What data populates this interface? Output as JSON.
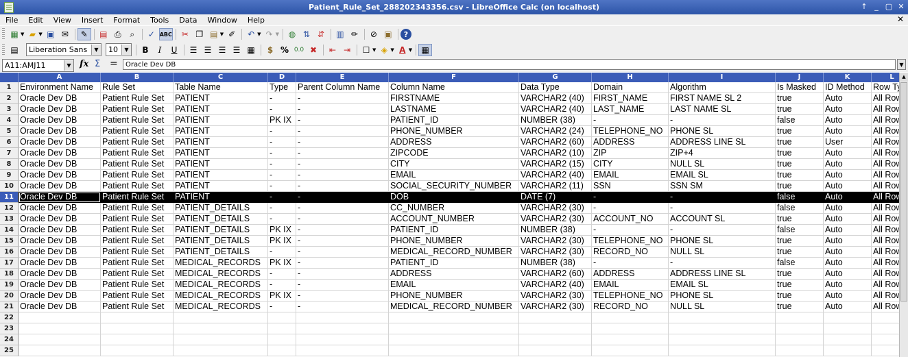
{
  "window": {
    "title": "Patient_Rule_Set_288202343356.csv - LibreOffice Calc (on localhost)",
    "buttons": [
      "↑",
      "_",
      "▢",
      "✕"
    ]
  },
  "menu": {
    "items": [
      "File",
      "Edit",
      "View",
      "Insert",
      "Format",
      "Tools",
      "Data",
      "Window",
      "Help"
    ],
    "close_doc": "✕"
  },
  "toolbar": {
    "font_name": "Liberation Sans",
    "font_size": "10",
    "bold": "B",
    "italic": "I",
    "underline": "U",
    "currency": "$",
    "percent": "%",
    "font_color": "A"
  },
  "formula_bar": {
    "name_box": "A11:AMJ11",
    "fx": "fx",
    "sigma": "Σ",
    "equals": "=",
    "content": "Oracle Dev DB"
  },
  "sheet": {
    "columns": [
      "A",
      "B",
      "C",
      "D",
      "E",
      "F",
      "G",
      "H",
      "I",
      "J",
      "K",
      "L"
    ],
    "row_numbers": [
      "1",
      "2",
      "3",
      "4",
      "5",
      "6",
      "7",
      "8",
      "9",
      "10",
      "11",
      "12",
      "13",
      "14",
      "15",
      "16",
      "17",
      "18",
      "19",
      "20",
      "21",
      "22",
      "23",
      "24",
      "25"
    ],
    "selected_row": 11,
    "rows": [
      [
        "Environment Name",
        "Rule Set",
        "Table Name",
        "Type",
        "Parent Column Name",
        "Column Name",
        "Data Type",
        "Domain",
        "Algorithm",
        "Is Masked",
        "ID Method",
        "Row Ty"
      ],
      [
        "Oracle Dev DB",
        "Patient Rule Set",
        "PATIENT",
        "-",
        "-",
        "FIRSTNAME",
        "VARCHAR2 (40)",
        "FIRST_NAME",
        "FIRST NAME SL 2",
        "true",
        "Auto",
        "All Row"
      ],
      [
        "Oracle Dev DB",
        "Patient Rule Set",
        "PATIENT",
        "-",
        "-",
        "LASTNAME",
        "VARCHAR2 (40)",
        "LAST_NAME",
        "LAST NAME SL",
        "true",
        "Auto",
        "All Row"
      ],
      [
        "Oracle Dev DB",
        "Patient Rule Set",
        "PATIENT",
        "PK IX",
        "-",
        "PATIENT_ID",
        "NUMBER (38)",
        "-",
        "-",
        "false",
        "Auto",
        "All Row"
      ],
      [
        "Oracle Dev DB",
        "Patient Rule Set",
        "PATIENT",
        "-",
        "-",
        "PHONE_NUMBER",
        "VARCHAR2 (24)",
        "TELEPHONE_NO",
        "PHONE SL",
        "true",
        "Auto",
        "All Row"
      ],
      [
        "Oracle Dev DB",
        "Patient Rule Set",
        "PATIENT",
        "-",
        "-",
        "ADDRESS",
        "VARCHAR2 (60)",
        "ADDRESS",
        "ADDRESS LINE SL",
        "true",
        "User",
        "All Row"
      ],
      [
        "Oracle Dev DB",
        "Patient Rule Set",
        "PATIENT",
        "-",
        "-",
        "ZIPCODE",
        "VARCHAR2 (10)",
        "ZIP",
        "ZIP+4",
        "true",
        "Auto",
        "All Row"
      ],
      [
        "Oracle Dev DB",
        "Patient Rule Set",
        "PATIENT",
        "-",
        "-",
        "CITY",
        "VARCHAR2 (15)",
        "CITY",
        "NULL SL",
        "true",
        "Auto",
        "All Row"
      ],
      [
        "Oracle Dev DB",
        "Patient Rule Set",
        "PATIENT",
        "-",
        "-",
        "EMAIL",
        "VARCHAR2 (40)",
        "EMAIL",
        "EMAIL SL",
        "true",
        "Auto",
        "All Row"
      ],
      [
        "Oracle Dev DB",
        "Patient Rule Set",
        "PATIENT",
        "-",
        "-",
        "SOCIAL_SECURITY_NUMBER",
        "VARCHAR2 (11)",
        "SSN",
        "SSN SM",
        "true",
        "Auto",
        "All Row"
      ],
      [
        "Oracle Dev DB",
        "Patient Rule Set",
        "PATIENT",
        "-",
        "-",
        "DOB",
        "DATE (7)",
        "-",
        "-",
        "false",
        "Auto",
        "All Row"
      ],
      [
        "Oracle Dev DB",
        "Patient Rule Set",
        "PATIENT_DETAILS",
        "-",
        "-",
        "CC_NUMBER",
        "VARCHAR2 (30)",
        "-",
        "-",
        "false",
        "Auto",
        "All Row"
      ],
      [
        "Oracle Dev DB",
        "Patient Rule Set",
        "PATIENT_DETAILS",
        "-",
        "-",
        "ACCOUNT_NUMBER",
        "VARCHAR2 (30)",
        "ACCOUNT_NO",
        "ACCOUNT SL",
        "true",
        "Auto",
        "All Row"
      ],
      [
        "Oracle Dev DB",
        "Patient Rule Set",
        "PATIENT_DETAILS",
        "PK IX",
        "-",
        "PATIENT_ID",
        "NUMBER (38)",
        "-",
        "-",
        "false",
        "Auto",
        "All Row"
      ],
      [
        "Oracle Dev DB",
        "Patient Rule Set",
        "PATIENT_DETAILS",
        "PK IX",
        "-",
        "PHONE_NUMBER",
        "VARCHAR2 (30)",
        "TELEPHONE_NO",
        "PHONE SL",
        "true",
        "Auto",
        "All Row"
      ],
      [
        "Oracle Dev DB",
        "Patient Rule Set",
        "PATIENT_DETAILS",
        "-",
        "-",
        "MEDICAL_RECORD_NUMBER",
        "VARCHAR2 (30)",
        "RECORD_NO",
        "NULL SL",
        "true",
        "Auto",
        "All Row"
      ],
      [
        "Oracle Dev DB",
        "Patient Rule Set",
        "MEDICAL_RECORDS",
        "PK IX",
        "-",
        "PATIENT_ID",
        "NUMBER (38)",
        "-",
        "-",
        "false",
        "Auto",
        "All Row"
      ],
      [
        "Oracle Dev DB",
        "Patient Rule Set",
        "MEDICAL_RECORDS",
        "-",
        "-",
        "ADDRESS",
        "VARCHAR2 (60)",
        "ADDRESS",
        "ADDRESS LINE SL",
        "true",
        "Auto",
        "All Row"
      ],
      [
        "Oracle Dev DB",
        "Patient Rule Set",
        "MEDICAL_RECORDS",
        "-",
        "-",
        "EMAIL",
        "VARCHAR2 (40)",
        "EMAIL",
        "EMAIL SL",
        "true",
        "Auto",
        "All Row"
      ],
      [
        "Oracle Dev DB",
        "Patient Rule Set",
        "MEDICAL_RECORDS",
        "PK IX",
        "-",
        "PHONE_NUMBER",
        "VARCHAR2 (30)",
        "TELEPHONE_NO",
        "PHONE SL",
        "true",
        "Auto",
        "All Row"
      ],
      [
        "Oracle Dev DB",
        "Patient Rule Set",
        "MEDICAL_RECORDS",
        "-",
        "-",
        "MEDICAL_RECORD_NUMBER",
        "VARCHAR2 (30)",
        "RECORD_NO",
        "NULL SL",
        "true",
        "Auto",
        "All Row"
      ]
    ]
  }
}
